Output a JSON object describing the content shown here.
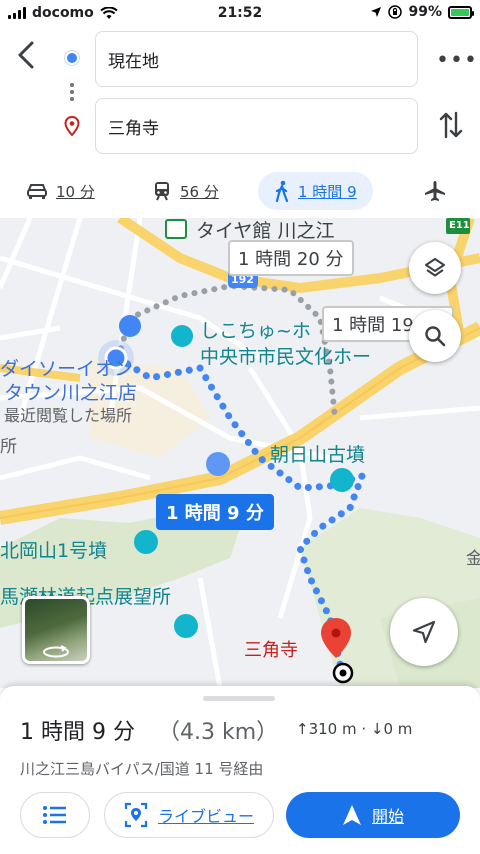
{
  "status_bar": {
    "carrier": "docomo",
    "time": "21:52",
    "battery": "99%"
  },
  "directions": {
    "origin": "現在地",
    "destination": "三角寺"
  },
  "modes": [
    {
      "name": "drive",
      "icon": "car-icon",
      "label": "10 分"
    },
    {
      "name": "transit",
      "icon": "train-icon",
      "label": "56 分"
    },
    {
      "name": "walk",
      "icon": "walking-icon",
      "label": "1 時間 9",
      "active": true
    },
    {
      "name": "flight",
      "icon": "airplane-icon",
      "label": ""
    }
  ],
  "map": {
    "place_labels": [
      "タイヤ館 川之江",
      "しこちゅ~ホ",
      "中央市市民文化ホー",
      "ダイソーイオン",
      "タウン川之江店",
      "最近閲覧した場所",
      "所",
      "朝日山古墳",
      "北岡山1号墳",
      "馬瀬林道起点展望所",
      "金"
    ],
    "road_shield": "192",
    "highway_label": "E11",
    "route_times": {
      "alt1": "1 時間 20 分",
      "alt2": "1 時間 19",
      "selected": "1 時間 9 分"
    },
    "destination_label": "三角寺",
    "colors": {
      "route": "#4285f4",
      "alt_route": "#9aa0a6",
      "road_major": "#f9d36b",
      "destination_pin": "#ea4335"
    }
  },
  "summary": {
    "duration": "1 時間 9 分",
    "distance": "（4.3 km）",
    "elevation": "↑310 m · ↓0 m",
    "via": "川之江三島バイパス/国道 11 号経由"
  },
  "actions": {
    "steps_icon": "list-icon",
    "live_view_label": "ライブビュー",
    "start_label": "開始"
  }
}
